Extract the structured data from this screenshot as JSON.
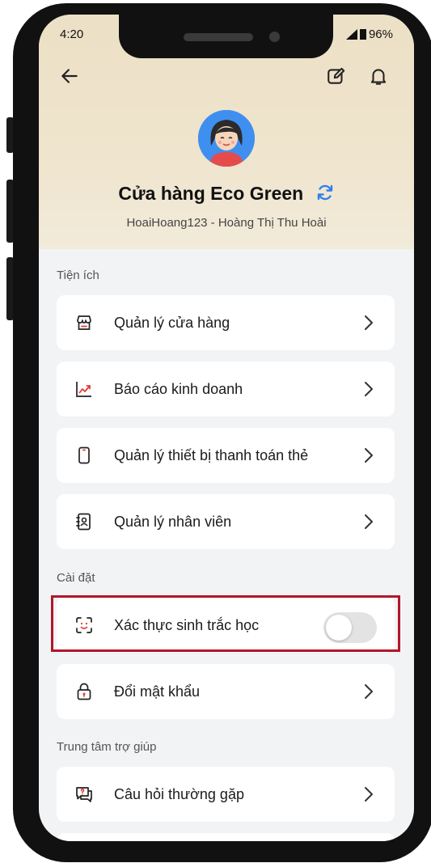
{
  "status_bar": {
    "time": "4:20",
    "battery": "96%"
  },
  "header": {
    "store_name": "Cửa hàng Eco Green",
    "username": "HoaiHoang123 - Hoàng Thị Thu Hoài"
  },
  "sections": {
    "utilities": "Tiện ích",
    "settings": "Cài đặt",
    "help": "Trung tâm trợ giúp"
  },
  "menu": {
    "store_manage": "Quản lý cửa hàng",
    "business_report": "Báo cáo kinh doanh",
    "card_device": "Quản lý thiết bị thanh toán thẻ",
    "staff": "Quản lý nhân viên",
    "biometric": "Xác thực sinh trắc học",
    "change_password": "Đổi mật khẩu",
    "faq": "Câu hỏi thường gặp"
  },
  "toggles": {
    "biometric_enabled": false
  },
  "colors": {
    "highlight": "#b3152a",
    "accent": "#3f8ff0",
    "header_bg": "#ece0c6"
  }
}
